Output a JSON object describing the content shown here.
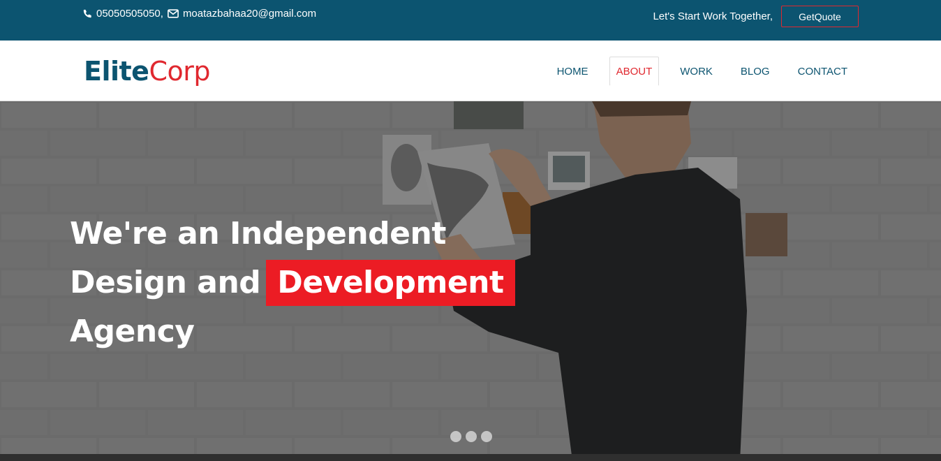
{
  "topbar": {
    "phone": "05050505050,",
    "email": "moatazbahaa20@gmail.com",
    "tagline": "Let's Start Work Together,",
    "quote_button": "GetQuote",
    "background_color": "#0c5470",
    "icons": [
      "phone-icon",
      "envelope-icon"
    ]
  },
  "brand": {
    "part1": "Elite",
    "part2": "Corp",
    "color_primary": "#0c5470",
    "color_accent": "#e0282f"
  },
  "nav": {
    "items": [
      {
        "label": "HOME"
      },
      {
        "label": "ABOUT",
        "active": true
      },
      {
        "label": "WORK"
      },
      {
        "label": "BLOG"
      },
      {
        "label": "CONTACT"
      }
    ]
  },
  "hero": {
    "line1": "We're an Independent",
    "line2_prefix": "Design and",
    "line2_highlight": "Development",
    "line3": "Agency",
    "highlight_color": "#ec1c24",
    "slides": 3
  }
}
